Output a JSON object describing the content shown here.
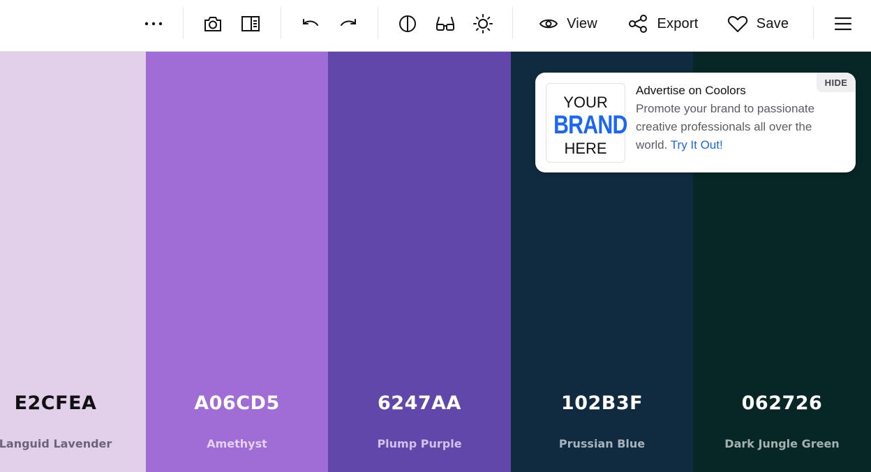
{
  "toolbar": {
    "more_icon": "more-horizontal-icon",
    "camera_icon": "camera-icon",
    "panel_icon": "side-panel-icon",
    "undo_icon": "undo-icon",
    "redo_icon": "redo-icon",
    "contrast_icon": "contrast-icon",
    "glasses_icon": "glasses-icon",
    "brightness_icon": "sun-icon",
    "view_label": "View",
    "export_label": "Export",
    "save_label": "Save",
    "menu_icon": "hamburger-menu-icon"
  },
  "palette": {
    "colors": [
      {
        "hex": "E2CFEA",
        "name": "Languid Lavender",
        "bg": "#E2CFEA",
        "hex_color": "#111111",
        "name_color": "#6b6478"
      },
      {
        "hex": "A06CD5",
        "name": "Amethyst",
        "bg": "#A06CD5",
        "hex_color": "#ffffff",
        "name_color": "#e3d3f3"
      },
      {
        "hex": "6247AA",
        "name": "Plump Purple",
        "bg": "#6247AA",
        "hex_color": "#ffffff",
        "name_color": "#cfc3ec"
      },
      {
        "hex": "102B3F",
        "name": "Prussian Blue",
        "bg": "#102B3F",
        "hex_color": "#ffffff",
        "name_color": "#a9b3bc"
      },
      {
        "hex": "062726",
        "name": "Dark Jungle Green",
        "bg": "#062726",
        "hex_color": "#ffffff",
        "name_color": "#a6b1b0"
      }
    ]
  },
  "ad": {
    "logo_your": "YOUR",
    "logo_brand": "BRAND",
    "logo_here": "HERE",
    "title": "Advertise on Coolors",
    "text": "Promote your brand to passionate creative professionals all over the world.",
    "link": "Try It Out!",
    "hide_label": "HIDE",
    "link_color": "#1967f2"
  }
}
